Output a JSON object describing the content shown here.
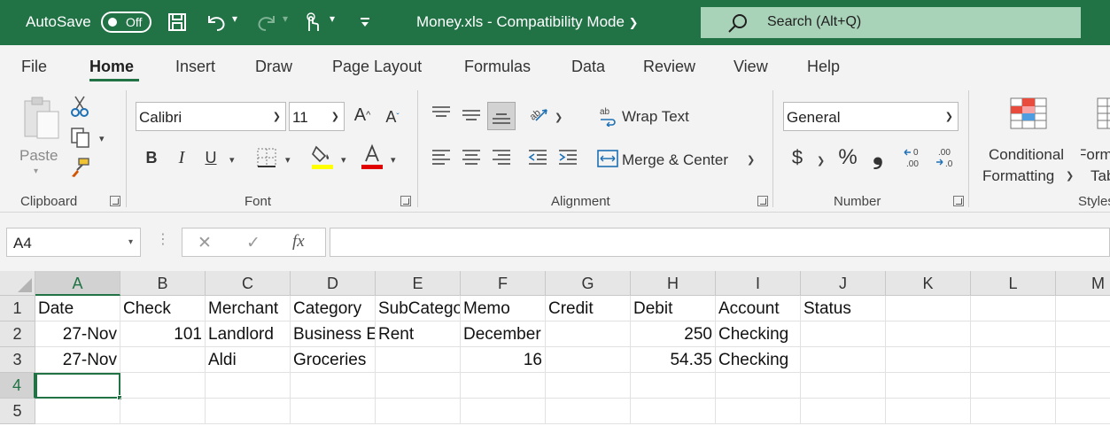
{
  "titlebar": {
    "autosave_label": "AutoSave",
    "autosave_state": "Off",
    "document_title": "Money.xls  -  Compatibility Mode",
    "search_placeholder": "Search (Alt+Q)",
    "accent_color": "#217346"
  },
  "menu": {
    "tabs": [
      "File",
      "Home",
      "Insert",
      "Draw",
      "Page Layout",
      "Formulas",
      "Data",
      "Review",
      "View",
      "Help"
    ],
    "active_tab": "Home"
  },
  "ribbon": {
    "clipboard": {
      "label": "Clipboard",
      "paste_label": "Paste"
    },
    "font": {
      "label": "Font",
      "font_name": "Calibri",
      "font_size": "11",
      "bold": "B",
      "italic": "I",
      "underline": "U"
    },
    "alignment": {
      "label": "Alignment",
      "wrap_text": "Wrap Text",
      "merge_center": "Merge & Center"
    },
    "number": {
      "label": "Number",
      "format": "General",
      "currency": "$",
      "percent": "%",
      "comma": "❟"
    },
    "styles": {
      "label": "Styles",
      "conditional_line1": "Conditional",
      "conditional_line2": "Formatting",
      "format_table_line1": "Format as",
      "format_table_line2": "Table"
    }
  },
  "formula_bar": {
    "name_box": "A4",
    "fx_label": "fx",
    "formula": ""
  },
  "sheet": {
    "columns": [
      "A",
      "B",
      "C",
      "D",
      "E",
      "F",
      "G",
      "H",
      "I",
      "J",
      "K",
      "L",
      "M"
    ],
    "rows": [
      "1",
      "2",
      "3",
      "4",
      "5"
    ],
    "active_cell": "A4",
    "cells": [
      [
        "Date",
        "Check",
        "Merchant",
        "Category",
        "SubCatego",
        "Memo",
        "Credit",
        "Debit",
        "Account",
        "Status",
        "",
        "",
        ""
      ],
      [
        "27-Nov",
        "101",
        "Landlord",
        "Business E",
        "Rent",
        "December",
        "",
        "250",
        "Checking",
        "",
        "",
        "",
        ""
      ],
      [
        "27-Nov",
        "",
        "Aldi",
        "Groceries",
        "",
        "16",
        "",
        "54.35",
        "Checking",
        "",
        "",
        "",
        ""
      ],
      [
        "",
        "",
        "",
        "",
        "",
        "",
        "",
        "",
        "",
        "",
        "",
        "",
        ""
      ],
      [
        "",
        "",
        "",
        "",
        "",
        "",
        "",
        "",
        "",
        "",
        "",
        "",
        ""
      ]
    ]
  }
}
